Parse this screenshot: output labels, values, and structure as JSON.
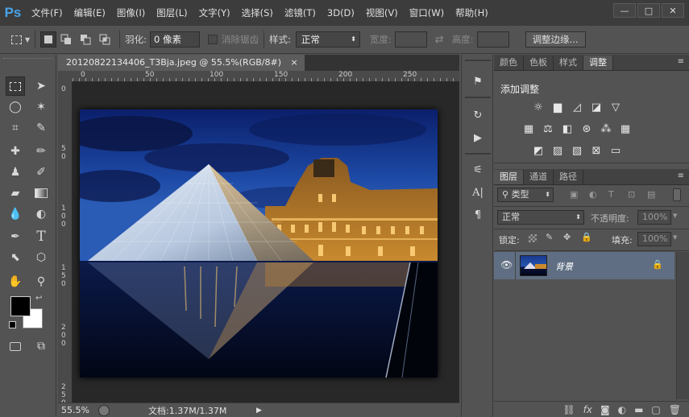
{
  "app": {
    "logo": "Ps"
  },
  "menu": [
    "文件(F)",
    "编辑(E)",
    "图像(I)",
    "图层(L)",
    "文字(Y)",
    "选择(S)",
    "滤镜(T)",
    "3D(D)",
    "视图(V)",
    "窗口(W)",
    "帮助(H)"
  ],
  "window_buttons": {
    "minimize": "—",
    "restore": "□",
    "close": "✕"
  },
  "options": {
    "feather_label": "羽化:",
    "feather_value": "0 像素",
    "antialias_label": "消除锯齿",
    "style_label": "样式:",
    "style_value": "正常",
    "width_label": "宽度:",
    "height_label": "高度:",
    "refine_edge": "调整边缘..."
  },
  "document": {
    "tab_title": "20120822134406_T3Bja.jpeg @ 55.5%(RGB/8#)",
    "tab_close": "×",
    "ruler_h": [
      "0",
      "50",
      "100",
      "150",
      "200",
      "250"
    ],
    "ruler_v": [
      "0",
      "5\n0",
      "1\n0\n0",
      "1\n5\n0",
      "2\n0\n0",
      "2\n5\n0"
    ],
    "zoom": "55.5%",
    "doc_info": "文档:1.37M/1.37M"
  },
  "adjust_panel": {
    "tabs": [
      "颜色",
      "色板",
      "样式",
      "调整"
    ],
    "active_tab": "调整",
    "title": "添加调整"
  },
  "layers_panel": {
    "tabs": [
      "图层",
      "通道",
      "路径"
    ],
    "active_tab": "图层",
    "filter_label": "类型",
    "blend_mode": "正常",
    "opacity_label": "不透明度:",
    "opacity_value": "100%",
    "lock_label": "锁定:",
    "fill_label": "填充:",
    "fill_value": "100%",
    "layers": [
      {
        "name": "背景",
        "locked": true,
        "visible": true
      }
    ]
  },
  "colors": {
    "foreground": "#000000",
    "background": "#ffffff",
    "selection": "#5f6e82",
    "logo": "#4aa3e8"
  }
}
